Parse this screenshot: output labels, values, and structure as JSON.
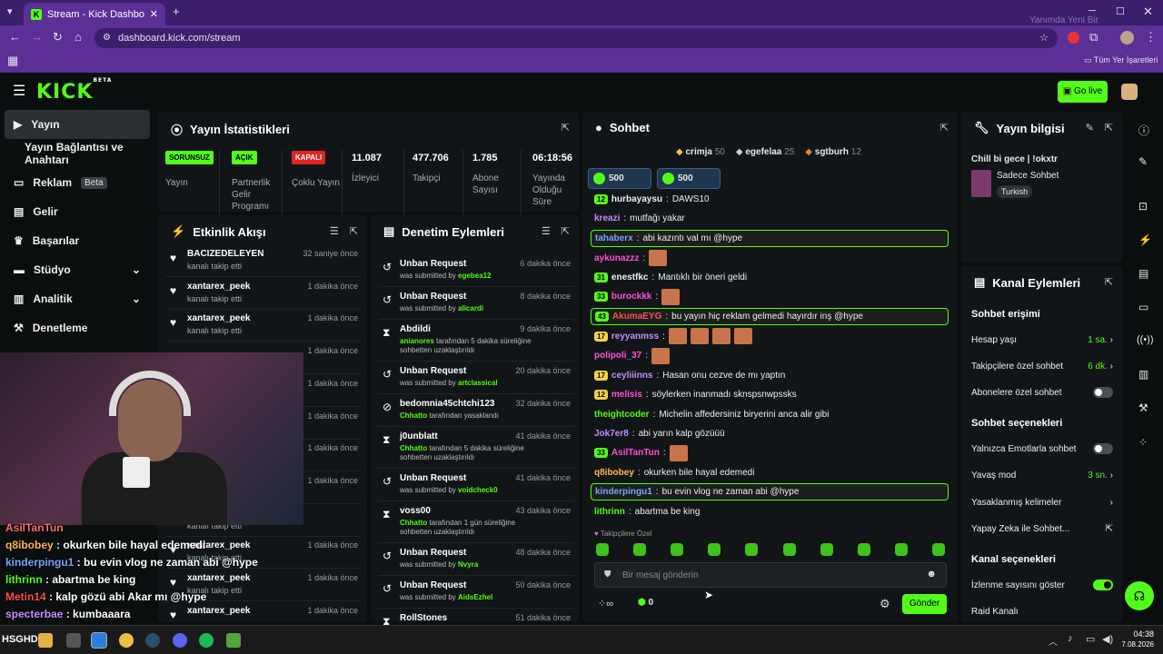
{
  "browser": {
    "tab_title": "Stream - Kick Dashboard",
    "url": "dashboard.kick.com/stream",
    "bookmarks_label": "Tüm Yer İşaretleri",
    "watermark": "Yanımda Yeni Bir"
  },
  "header": {
    "logo": "KICK",
    "beta": "BETA",
    "go_live": "Go live"
  },
  "sidebar": {
    "items": [
      {
        "label": "Yayın",
        "icon": "stream-icon"
      },
      {
        "label": "Yayın Bağlantısı ve Anahtarı",
        "icon": "key-icon"
      },
      {
        "label": "Reklam",
        "icon": "monitor-icon",
        "badge": "Beta"
      },
      {
        "label": "Gelir",
        "icon": "revenue-icon"
      },
      {
        "label": "Başarılar",
        "icon": "trophy-icon"
      },
      {
        "label": "Stüdyo",
        "icon": "studio-icon"
      },
      {
        "label": "Analitik",
        "icon": "chart-icon"
      },
      {
        "label": "Denetleme",
        "icon": "hammer-icon"
      }
    ]
  },
  "stats": {
    "title": "Yayın İstatistikleri",
    "columns": [
      {
        "tag": "SORUNSUZ",
        "label": "Yayın",
        "tag_color": "#53fc18"
      },
      {
        "tag": "AÇIK",
        "label": "Partnerlik Gelir Programı",
        "tag_color": "#53fc18"
      },
      {
        "tag": "KAPALI",
        "label": "Çoklu Yayın",
        "tag_color": "#e02424"
      },
      {
        "value": "11.087",
        "label": "İzleyici"
      },
      {
        "value": "477.706",
        "label": "Takipçi"
      },
      {
        "value": "1.785",
        "label": "Abone Sayısı"
      },
      {
        "value": "06:18:56",
        "label": "Yayında Olduğu Süre"
      }
    ]
  },
  "activity": {
    "title": "Etkinlik Akışı",
    "items": [
      {
        "name": "BACIZEDELEYEN",
        "sub": "kanalı takip etti",
        "time": "32 saniye önce"
      },
      {
        "name": "xantarex_peek",
        "sub": "kanalı takip etti",
        "time": "1 dakika önce"
      },
      {
        "name": "xantarex_peek",
        "sub": "kanalı takip etti",
        "time": "1 dakika önce"
      },
      {
        "name": "",
        "sub": "",
        "time": "1 dakika önce"
      },
      {
        "name": "",
        "sub": "",
        "time": "1 dakika önce"
      },
      {
        "name": "",
        "sub": "",
        "time": "1 dakika önce"
      },
      {
        "name": "",
        "sub": "",
        "time": "1 dakika önce"
      },
      {
        "name": "",
        "sub": "",
        "time": "1 dakika önce"
      },
      {
        "name": "",
        "sub": "kanalı takip etti",
        "time": ""
      },
      {
        "name": "xantarex_peek",
        "sub": "kanalı takip etti",
        "time": "1 dakika önce"
      },
      {
        "name": "xantarex_peek",
        "sub": "kanalı takip etti",
        "time": "1 dakika önce"
      },
      {
        "name": "xantarex_peek",
        "sub": "",
        "time": "1 dakika önce"
      }
    ]
  },
  "moderation": {
    "title": "Denetim Eylemleri",
    "items": [
      {
        "icon": "undo-icon",
        "name": "Unban Request",
        "pre": "was submitted by ",
        "who": "egebea12",
        "post": "",
        "time": "6 dakika önce"
      },
      {
        "icon": "undo-icon",
        "name": "Unban Request",
        "pre": "was submitted by ",
        "who": "alicardi",
        "post": "",
        "time": "8 dakika önce"
      },
      {
        "icon": "hourglass-icon",
        "name": "Abdildi",
        "pre": "",
        "who": "anianores",
        "post": " tarafından 5 dakika süreliğine sohbetten uzaklaştırıldı",
        "time": "9 dakika önce"
      },
      {
        "icon": "undo-icon",
        "name": "Unban Request",
        "pre": "was submitted by ",
        "who": "artclassical",
        "post": "",
        "time": "20 dakika önce"
      },
      {
        "icon": "ban-icon",
        "name": "bedomnia45chtchi123",
        "pre": "",
        "who": "Chhatto",
        "post": " tarafından yasaklandı",
        "time": "32 dakika önce"
      },
      {
        "icon": "hourglass-icon",
        "name": "j0unblatt",
        "pre": "",
        "who": "Chhatto",
        "post": " tarafından 5 dakika süreliğine sohbetten uzaklaştırıldı",
        "time": "41 dakika önce"
      },
      {
        "icon": "undo-icon",
        "name": "Unban Request",
        "pre": "was submitted by ",
        "who": "voidcheck0",
        "post": "",
        "time": "41 dakika önce"
      },
      {
        "icon": "hourglass-icon",
        "name": "voss00",
        "pre": "",
        "who": "Chhatto",
        "post": " tarafından 1 gün süreliğine sohbetten uzaklaştırıldı",
        "time": "43 dakika önce"
      },
      {
        "icon": "undo-icon",
        "name": "Unban Request",
        "pre": "was submitted by ",
        "who": "Nvyra",
        "post": "",
        "time": "48 dakika önce"
      },
      {
        "icon": "undo-icon",
        "name": "Unban Request",
        "pre": "was submitted by ",
        "who": "AidsEzhel",
        "post": "",
        "time": "50 dakika önce"
      },
      {
        "icon": "hourglass-icon",
        "name": "RollStones",
        "pre": "",
        "who": "",
        "post": "",
        "time": "51 dakika önce"
      }
    ]
  },
  "chat": {
    "title": "Sohbet",
    "top_gifters": [
      {
        "name": "crimja",
        "count": "50"
      },
      {
        "name": "egefelaa",
        "count": "25"
      },
      {
        "name": "sgtburh",
        "count": "12"
      }
    ],
    "pinned": [
      {
        "count": "500"
      },
      {
        "count": "500"
      }
    ],
    "messages": [
      {
        "lvl": "12",
        "lvlcolor": "#53fc18",
        "user": "hurbayaysu",
        "ucolor": "#eeeeee",
        "text": "DAWS10",
        "hl": false,
        "emotes": 0
      },
      {
        "lvl": "",
        "lvlcolor": "",
        "user": "kreazi",
        "ucolor": "#c58cff",
        "text": "mutfağı yakar",
        "hl": false,
        "emotes": 0
      },
      {
        "lvl": "",
        "lvlcolor": "",
        "user": "tahaberx",
        "ucolor": "#7aa2ff",
        "text": "abi kazıntı val mı @hype",
        "hl": true,
        "emotes": 0
      },
      {
        "lvl": "",
        "lvlcolor": "",
        "user": "aykunazzz",
        "ucolor": "#ff4fd8",
        "text": "",
        "hl": false,
        "emotes": 1
      },
      {
        "lvl": "31",
        "lvlcolor": "#53fc18",
        "user": "enestfkc",
        "ucolor": "#eeeeee",
        "text": "Mantıklı bir öneri geldi",
        "hl": false,
        "emotes": 0
      },
      {
        "lvl": "33",
        "lvlcolor": "#53fc18",
        "user": "burockkk",
        "ucolor": "#ff4fd8",
        "text": "",
        "hl": false,
        "emotes": 1
      },
      {
        "lvl": "43",
        "lvlcolor": "#53fc18",
        "user": "AkumaEYG",
        "ucolor": "#ff4f4f",
        "text": "bu yayın hiç reklam gelmedi hayırdır inş @hype",
        "hl": true,
        "emotes": 0
      },
      {
        "lvl": "17",
        "lvlcolor": "#f5d142",
        "user": "reyyanmss",
        "ucolor": "#c58cff",
        "text": "",
        "hl": false,
        "emotes": 4
      },
      {
        "lvl": "",
        "lvlcolor": "",
        "user": "polipoli_37",
        "ucolor": "#ff4fd8",
        "text": "",
        "hl": false,
        "emotes": 1
      },
      {
        "lvl": "17",
        "lvlcolor": "#f5d142",
        "user": "ceyliiinns",
        "ucolor": "#c58cff",
        "text": "Hasan onu cezve de mı yaptın",
        "hl": false,
        "emotes": 0
      },
      {
        "lvl": "12",
        "lvlcolor": "#f5d142",
        "user": "melisis",
        "ucolor": "#ff4fd8",
        "text": "söylerken inanmadı sknspsnwpssks",
        "hl": false,
        "emotes": 0
      },
      {
        "lvl": "",
        "lvlcolor": "",
        "user": "theightcoder",
        "ucolor": "#53fc18",
        "text": "Michelin affedersiniz biryerini anca alir gibi",
        "hl": false,
        "emotes": 0
      },
      {
        "lvl": "",
        "lvlcolor": "",
        "user": "Jok7er8",
        "ucolor": "#c58cff",
        "text": "abi yarın kalp gözüüü",
        "hl": false,
        "emotes": 0
      },
      {
        "lvl": "33",
        "lvlcolor": "#53fc18",
        "user": "AsilTanTun",
        "ucolor": "#ff4fd8",
        "text": "",
        "hl": false,
        "emotes": 1
      },
      {
        "lvl": "",
        "lvlcolor": "",
        "user": "q8ibobey",
        "ucolor": "#ffb84f",
        "text": "okurken bile hayal edemedi",
        "hl": false,
        "emotes": 0
      },
      {
        "lvl": "",
        "lvlcolor": "",
        "user": "kinderpingu1",
        "ucolor": "#7aa2ff",
        "text": "bu evin vlog ne zaman abi @hype",
        "hl": true,
        "emotes": 0
      },
      {
        "lvl": "",
        "lvlcolor": "",
        "user": "lithrinn",
        "ucolor": "#53fc18",
        "text": "abartma be king",
        "hl": false,
        "emotes": 0
      }
    ],
    "followers_only": "Takipçilere Özel",
    "input_placeholder": "Bir mesaj gönderin",
    "points": "0",
    "send": "Gönder"
  },
  "stream_info": {
    "title": "Yayın bilgisi",
    "stream_title": "Chill bi gece | !okxtr",
    "category": "Sadece Sohbet",
    "language": "Turkish"
  },
  "channel_actions": {
    "title": "Kanal Eylemleri",
    "chat_access": "Sohbet erişimi",
    "account_age": {
      "label": "Hesap yaşı",
      "value": "1 sa."
    },
    "followers_only": {
      "label": "Takipçilere özel sohbet",
      "value": "6 dk."
    },
    "subs_only": {
      "label": "Abonelere özel sohbet",
      "on": false
    },
    "chat_options": "Sohbet seçenekleri",
    "emote_only": {
      "label": "Yalnızca Emotlarla sohbet",
      "on": false
    },
    "slow_mode": {
      "label": "Yavaş mod",
      "value": "3 sn."
    },
    "banned_words": {
      "label": "Yasaklanmış kelimeler"
    },
    "ai_chat": {
      "label": "Yapay Zeka ile Sohbet..."
    },
    "channel_options": "Kanal seçenekleri",
    "show_viewers": {
      "label": "İzlenme sayısını göster",
      "on": true
    },
    "raid": {
      "label": "Raid Kanalı"
    }
  },
  "stream_overlay_chat": [
    {
      "user": "AsilTanTun",
      "text": "",
      "color": "#ff6b6b"
    },
    {
      "user": "q8ibobey",
      "text": "okurken bile hayal edemedi",
      "color": "#ffb84f"
    },
    {
      "user": "kinderpingu1",
      "text": "bu evin vlog ne zaman abi @hype",
      "color": "#7aa2ff"
    },
    {
      "user": "lithrinn",
      "text": "abartma be king",
      "color": "#53fc18"
    },
    {
      "user": "Metin14",
      "text": "kalp gözü abi Akar mı @hype",
      "color": "#ff4f4f"
    },
    {
      "user": "specterbae",
      "text": "kumbaaara",
      "color": "#c58cff"
    }
  ],
  "taskbar": {
    "label": "HSGHDSG",
    "time": "04:38",
    "date": "7.08.2026"
  }
}
